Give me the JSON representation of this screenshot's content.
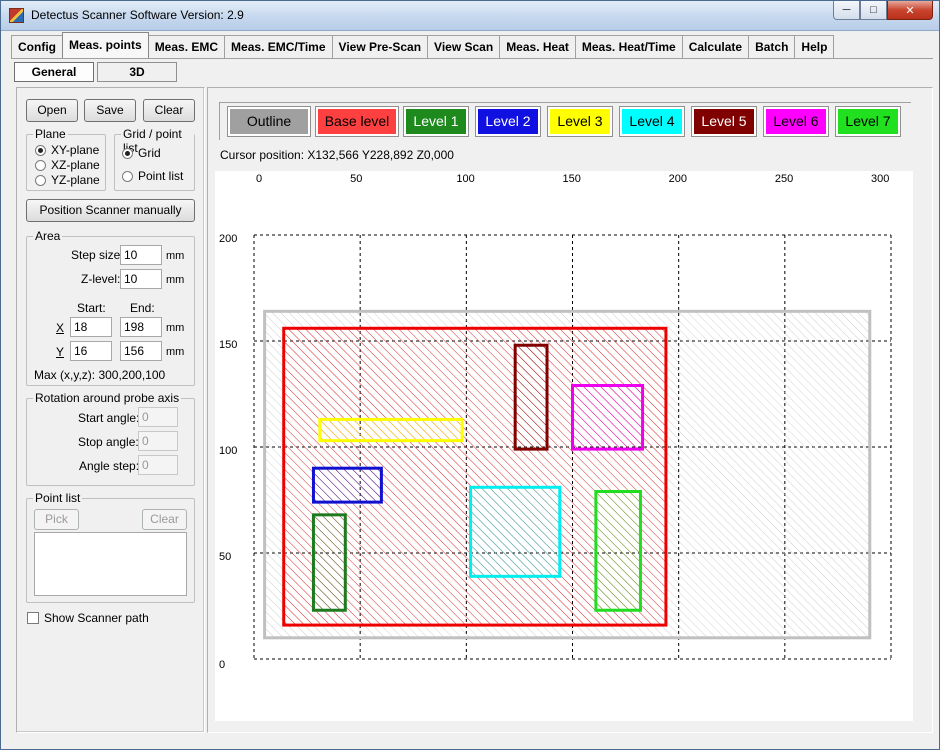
{
  "window": {
    "title": "Detectus Scanner Software Version: 2.9"
  },
  "tabs": [
    "Config",
    "Meas. points",
    "Meas. EMC",
    "Meas. EMC/Time",
    "View Pre-Scan",
    "View Scan",
    "Meas. Heat",
    "Meas. Heat/Time",
    "Calculate",
    "Batch",
    "Help"
  ],
  "active_tab": "Meas. points",
  "subtabs": [
    "General",
    "3D"
  ],
  "active_subtab": "General",
  "file_buttons": {
    "open": "Open",
    "save": "Save",
    "clear": "Clear"
  },
  "plane": {
    "label": "Plane",
    "options": [
      "XY-plane",
      "XZ-plane",
      "YZ-plane"
    ],
    "selected": "XY-plane"
  },
  "grid_point": {
    "label": "Grid / point list",
    "options": [
      "Grid",
      "Point list"
    ],
    "selected": "Grid"
  },
  "position_button": "Position Scanner manually",
  "area": {
    "label": "Area",
    "step_size_label": "Step size:",
    "step_size": "10",
    "z_level_label": "Z-level:",
    "z_level": "10",
    "unit": "mm",
    "start_label": "Start:",
    "end_label": "End:",
    "x_label": "X",
    "x_start": "18",
    "x_end": "198",
    "y_label": "Y",
    "y_start": "16",
    "y_end": "156",
    "max_text": "Max (x,y,z): 300,200,100"
  },
  "rotation": {
    "label": "Rotation around probe axis",
    "start_label": "Start angle:",
    "start": "0",
    "stop_label": "Stop angle:",
    "stop": "0",
    "step_label": "Angle step:",
    "step": "0"
  },
  "point_list": {
    "label": "Point list",
    "pick": "Pick",
    "clear": "Clear"
  },
  "show_path_label": "Show Scanner path",
  "levels": [
    {
      "label": "Outline",
      "bg": "#a0a0a0",
      "fg": "#000000"
    },
    {
      "label": "Base level",
      "bg": "#ff4040",
      "fg": "#000000"
    },
    {
      "label": "Level 1",
      "bg": "#1e8a1e",
      "fg": "#ffffff"
    },
    {
      "label": "Level 2",
      "bg": "#1010e0",
      "fg": "#ffffff"
    },
    {
      "label": "Level 3",
      "bg": "#ffff00",
      "fg": "#000000"
    },
    {
      "label": "Level 4",
      "bg": "#00ffff",
      "fg": "#000000"
    },
    {
      "label": "Level 5",
      "bg": "#800000",
      "fg": "#ffffff"
    },
    {
      "label": "Level 6",
      "bg": "#ff00ff",
      "fg": "#000000"
    },
    {
      "label": "Level 7",
      "bg": "#20e020",
      "fg": "#000000"
    }
  ],
  "cursor_position": "Cursor position: X132,566 Y228,892 Z0,000",
  "plot": {
    "x_ticks": [
      "0",
      "50",
      "100",
      "150",
      "200",
      "250",
      "300"
    ],
    "y_ticks": [
      "200",
      "150",
      "100",
      "50",
      "0"
    ],
    "x_range": [
      0,
      300
    ],
    "y_range": [
      0,
      200
    ],
    "grid_step": 50,
    "shapes": [
      {
        "level": "Outline",
        "color": "#c0c0c0",
        "x": [
          5,
          290
        ],
        "y": [
          10,
          164
        ]
      },
      {
        "level": "Base level",
        "color": "#ee0000",
        "x": [
          14,
          194
        ],
        "y": [
          16,
          156
        ]
      },
      {
        "level": "Level 1",
        "color": "#1e7a1e",
        "x": [
          28,
          43
        ],
        "y": [
          23,
          68
        ]
      },
      {
        "level": "Level 2",
        "color": "#1010d0",
        "x": [
          28,
          60
        ],
        "y": [
          74,
          90
        ]
      },
      {
        "level": "Level 3",
        "color": "#ffff00",
        "x": [
          31,
          98
        ],
        "y": [
          103,
          113
        ]
      },
      {
        "level": "Level 4",
        "color": "#00eeee",
        "x": [
          102,
          144
        ],
        "y": [
          39,
          81
        ]
      },
      {
        "level": "Level 5",
        "color": "#800000",
        "x": [
          123,
          138
        ],
        "y": [
          99,
          148
        ]
      },
      {
        "level": "Level 6",
        "color": "#ee00ee",
        "x": [
          150,
          183
        ],
        "y": [
          99,
          129
        ]
      },
      {
        "level": "Level 7",
        "color": "#20dd20",
        "x": [
          161,
          182
        ],
        "y": [
          23,
          79
        ]
      }
    ]
  }
}
